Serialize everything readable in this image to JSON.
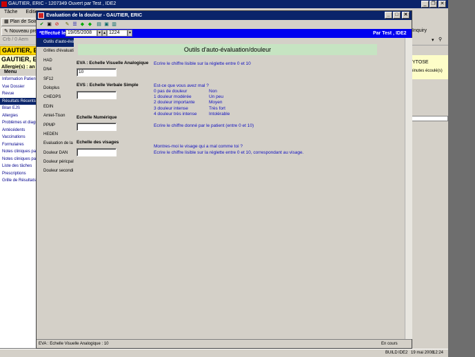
{
  "bg_window": {
    "title": "GAUTIER, ERIC - 1207349 Ouvert par Test , IDE2",
    "menu": [
      "Tâche",
      "Edition"
    ],
    "toolbar1": [
      "Plan de Soins"
    ],
    "toolbar2": [
      "Nouveau prév"
    ],
    "toolbar3_text": "Crb / 0 Aem",
    "inquiry_label": "Inquiry",
    "patient_name": "GAUTIER, E",
    "patient_name_2": "GAUTIER, E",
    "allergy_text": "Allergie(s) : an",
    "menu_header": "Menu",
    "nav_items": [
      "Information Patient",
      "Vue Dossier",
      "Revue",
      "Résultats Récents",
      "Bilan EJS",
      "Allergies",
      "Problèmes et diagnc",
      "Antécédents",
      "Vaccinations",
      "Formulaires",
      "Notes cliniques par t",
      "Notes cliniques par r",
      "Liste des tâches",
      "Prescriptions",
      "Grille de Résultats"
    ],
    "nav_selected_index": 3,
    "right_text_1": "YTOSE",
    "right_text_2": "ninutes écoulé(s)",
    "statusbar_user": "BUILD",
    "statusbar_role": "IDE2",
    "statusbar_date": "19 mai 2008",
    "statusbar_time": "12:24"
  },
  "dialog": {
    "title": "Evaluation de la douleur - GAUTIER, ERIC",
    "effectue_label": "*Effectué le",
    "date_value": "19/05/2008",
    "time_value": "1224",
    "par_text": "Par Test , IDE2",
    "nav_items": [
      "Outils d'auto-éva",
      "Grilles d'évaluati",
      "HAD",
      "DN4",
      "SF12",
      "Doloplus",
      "CHEOPS",
      "EDIN",
      "Amiel-Tison",
      "PPMP",
      "HEDEN",
      "Evaluation de la",
      "Douleur DAN",
      "Douleur péricpal",
      "Douleur secondi"
    ],
    "nav_selected_index": 0,
    "content_title": "Outils d'auto-évaluation/douleur",
    "eva": {
      "title": "EVA : Echelle Visuelle Analogique",
      "value": "10",
      "instruction": "Ecrire le chiffre lisible sur la réglette entre 0 et 10"
    },
    "evs": {
      "title": "EVS : Echelle Verbale Simple",
      "value": "",
      "question": "Est-ce que vous avez mal ?",
      "scale": [
        {
          "label": "0  pas de douleur",
          "meaning": "Non"
        },
        {
          "label": "1  douleur modérée",
          "meaning": "Un peu"
        },
        {
          "label": "2  douleur importante",
          "meaning": "Moyen"
        },
        {
          "label": "3  douleur intense",
          "meaning": "Très fort"
        },
        {
          "label": "4  douleur très intense",
          "meaning": "Intolérable"
        }
      ]
    },
    "numerique": {
      "title": "Echelle Numérique",
      "value": "",
      "instruction": "Ecrire le chiffre donné par le patient (entre 0 et 10)"
    },
    "visages": {
      "title": "Echelle des visages",
      "value": "",
      "instruction_1": "Montres-moi le visage qui a mal comme toi ?",
      "instruction_2": "Ecrire le chiffre lisible sur la réglette entre 0 et 10, correspondant au visage."
    },
    "status_left": "EVA : Echelle Visuelle Analogique : 10",
    "status_right": "En cours"
  }
}
